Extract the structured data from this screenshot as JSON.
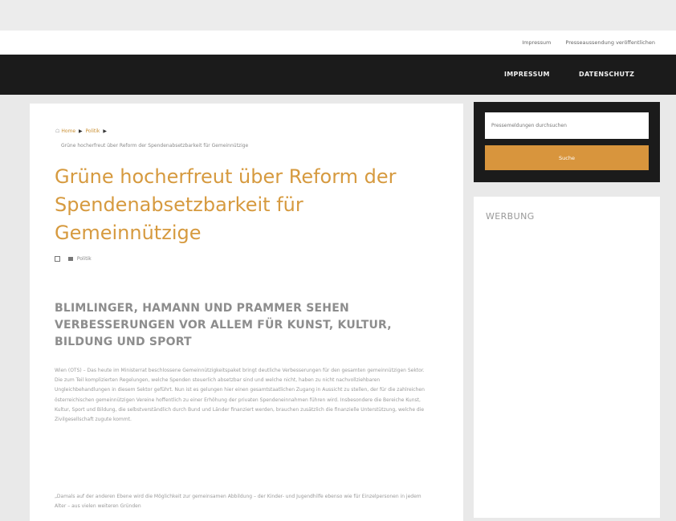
{
  "top_links": {
    "impressum": "Impressum",
    "publish": "Presseaussendung veröffentlichen"
  },
  "nav": {
    "impressum": "IMPRESSUM",
    "datenschutz": "DATENSCHUTZ"
  },
  "breadcrumb": {
    "home": "Home",
    "category": "Politik",
    "current": "Grüne hocherfreut über Reform der Spendenabsetzbarkeit für Gemeinnützige"
  },
  "article": {
    "title": "Grüne hocherfreut über Reform der Spendenabsetzbarkeit für Gemeinnützige",
    "category": "Politik",
    "subtitle": "BLIMLINGER, HAMANN UND PRAMMER SEHEN VERBESSERUNGEN VOR ALLEM FÜR KUNST, KULTUR, BILDUNG UND SPORT",
    "paragraph1": "Wien (OTS) – Das heute im Ministerrat beschlossene Gemeinnützigkeitspaket bringt deutliche Verbesserungen für den gesamten gemeinnützigen Sektor. Die zum Teil komplizierten Regelungen, welche Spenden steuerlich absetzbar sind und welche nicht, haben zu nicht nachvollziehbaren Ungleichbehandlungen in diesem Sektor geführt. Nun ist es gelungen hier einen gesamtstaatlichen Zugang in Aussicht zu stellen, der für die zahlreichen österreichischen gemeinnützigen Vereine hoffentlich zu einer Erhöhung der privaten Spendeneinnahmen führen wird. Insbesondere die Bereiche Kunst, Kultur, Sport und Bildung, die selbstverständlich durch Bund und Länder finanziert werden, brauchen zusätzlich die finanzielle Unterstützung, welche die Zivilgesellschaft zugute kommt.",
    "paragraph2": "„Damals auf der anderen Ebene wird die Möglichkeit zur gemeinsamen Abbildung – der Kinder- und Jugendhilfe ebenso wie für Einzelpersonen in jedem Alter – aus vielen weiteren Gründen"
  },
  "sidebar": {
    "search_placeholder": "Pressemeldungen durchsuchen",
    "search_button": "Suche",
    "ad_label": "WERBUNG"
  }
}
